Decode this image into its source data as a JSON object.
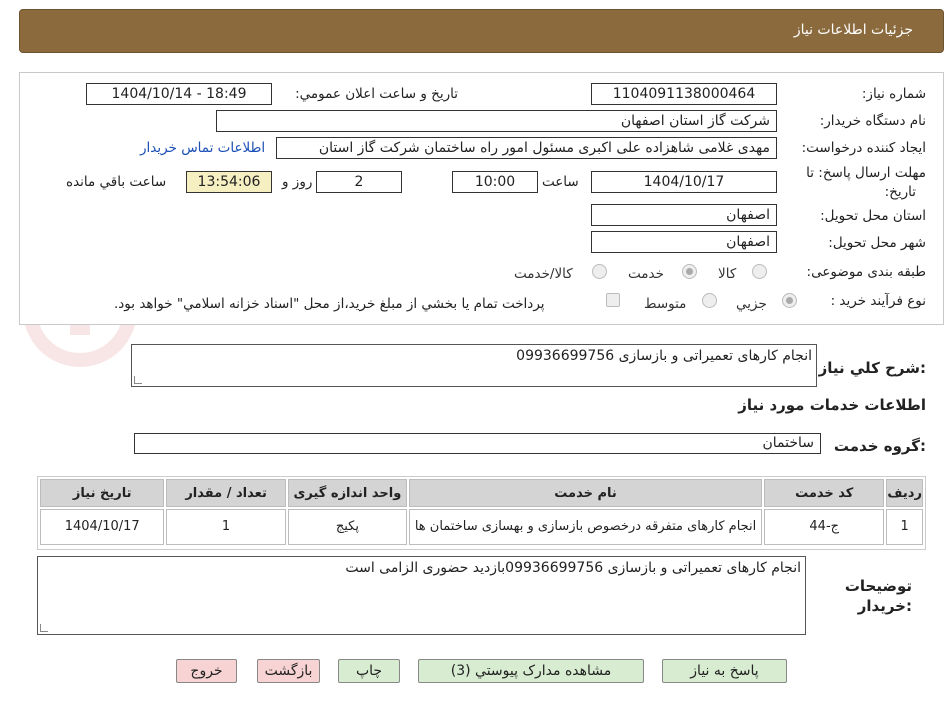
{
  "header": {
    "title": "جزئیات اطلاعات نیاز"
  },
  "fields": {
    "need_number_label": "شماره نیاز:",
    "need_number": "1104091138000464",
    "announce_label": "تاریخ و ساعت اعلان عمومي:",
    "announce_value": "1404/10/14 - 18:49",
    "buyer_org_label": "نام دستگاه خريدار:",
    "buyer_org": "شرکت گاز استان اصفهان",
    "requester_label": "ايجاد کننده درخواست:",
    "requester": "مهدی غلامی شاهزاده علی اکبری مسئول امور راه ساختمان شرکت گاز استان",
    "contact_link": "اطلاعات تماس خريدار",
    "deadline_label_1": "مهلت ارسال پاسخ: تا",
    "deadline_label_2": "تاريخ:",
    "deadline_date": "1404/10/17",
    "time_label": "ساعت",
    "deadline_time": "10:00",
    "days_value": "2",
    "days_label": "روز و",
    "remaining_time": "13:54:06",
    "remaining_label": "ساعت باقي مانده",
    "province_label": "استان محل تحويل:",
    "province": "اصفهان",
    "city_label": "شهر محل تحويل:",
    "city": "اصفهان",
    "category_label": "طبقه بندی موضوعی:",
    "category_options": [
      "کالا",
      "خدمت",
      "کالا/خدمت"
    ],
    "process_label": "نوع فرآيند خريد :",
    "process_options": [
      "جزيي",
      "متوسط"
    ],
    "payment_note": "پرداخت تمام يا بخشي از مبلغ خريد،از محل \"اسناد خزانه اسلامي\" خواهد بود."
  },
  "description": {
    "label": "شرح کلي نياز:",
    "value": "انجام کارهای تعمیراتی و بازسازی 09936699756"
  },
  "services_section": {
    "title": "اطلاعات خدمات مورد نياز",
    "group_label": "گروه خدمت:",
    "group_value": "ساختمان"
  },
  "table": {
    "headers": [
      "رديف",
      "کد خدمت",
      "نام خدمت",
      "واحد اندازه گيری",
      "تعداد / مقدار",
      "تاريخ نياز"
    ],
    "rows": [
      [
        "1",
        "ج-44",
        "انجام کارهای متفرقه درخصوص بازسازی و بهسازی ساختمان ها",
        "پکيج",
        "1",
        "1404/10/17"
      ]
    ]
  },
  "buyer_notes": {
    "label_1": "توضيحات",
    "label_2": "خريدار:",
    "value": "انجام کارهای تعمیراتی و بازسازی 09936699756بازدید حضوری الزامی است"
  },
  "buttons": {
    "reply": "پاسخ به نياز",
    "attachments": "مشاهده مدارک پيوستي (3)",
    "print": "چاپ",
    "back": "بازگشت",
    "exit": "خروج"
  },
  "colors": {
    "header_bg": "#8b6a3d",
    "button_green": "#d7ecd0",
    "button_pink": "#f7d3d3",
    "timer_bg": "#f5efc2",
    "link": "#1a4fb5"
  }
}
